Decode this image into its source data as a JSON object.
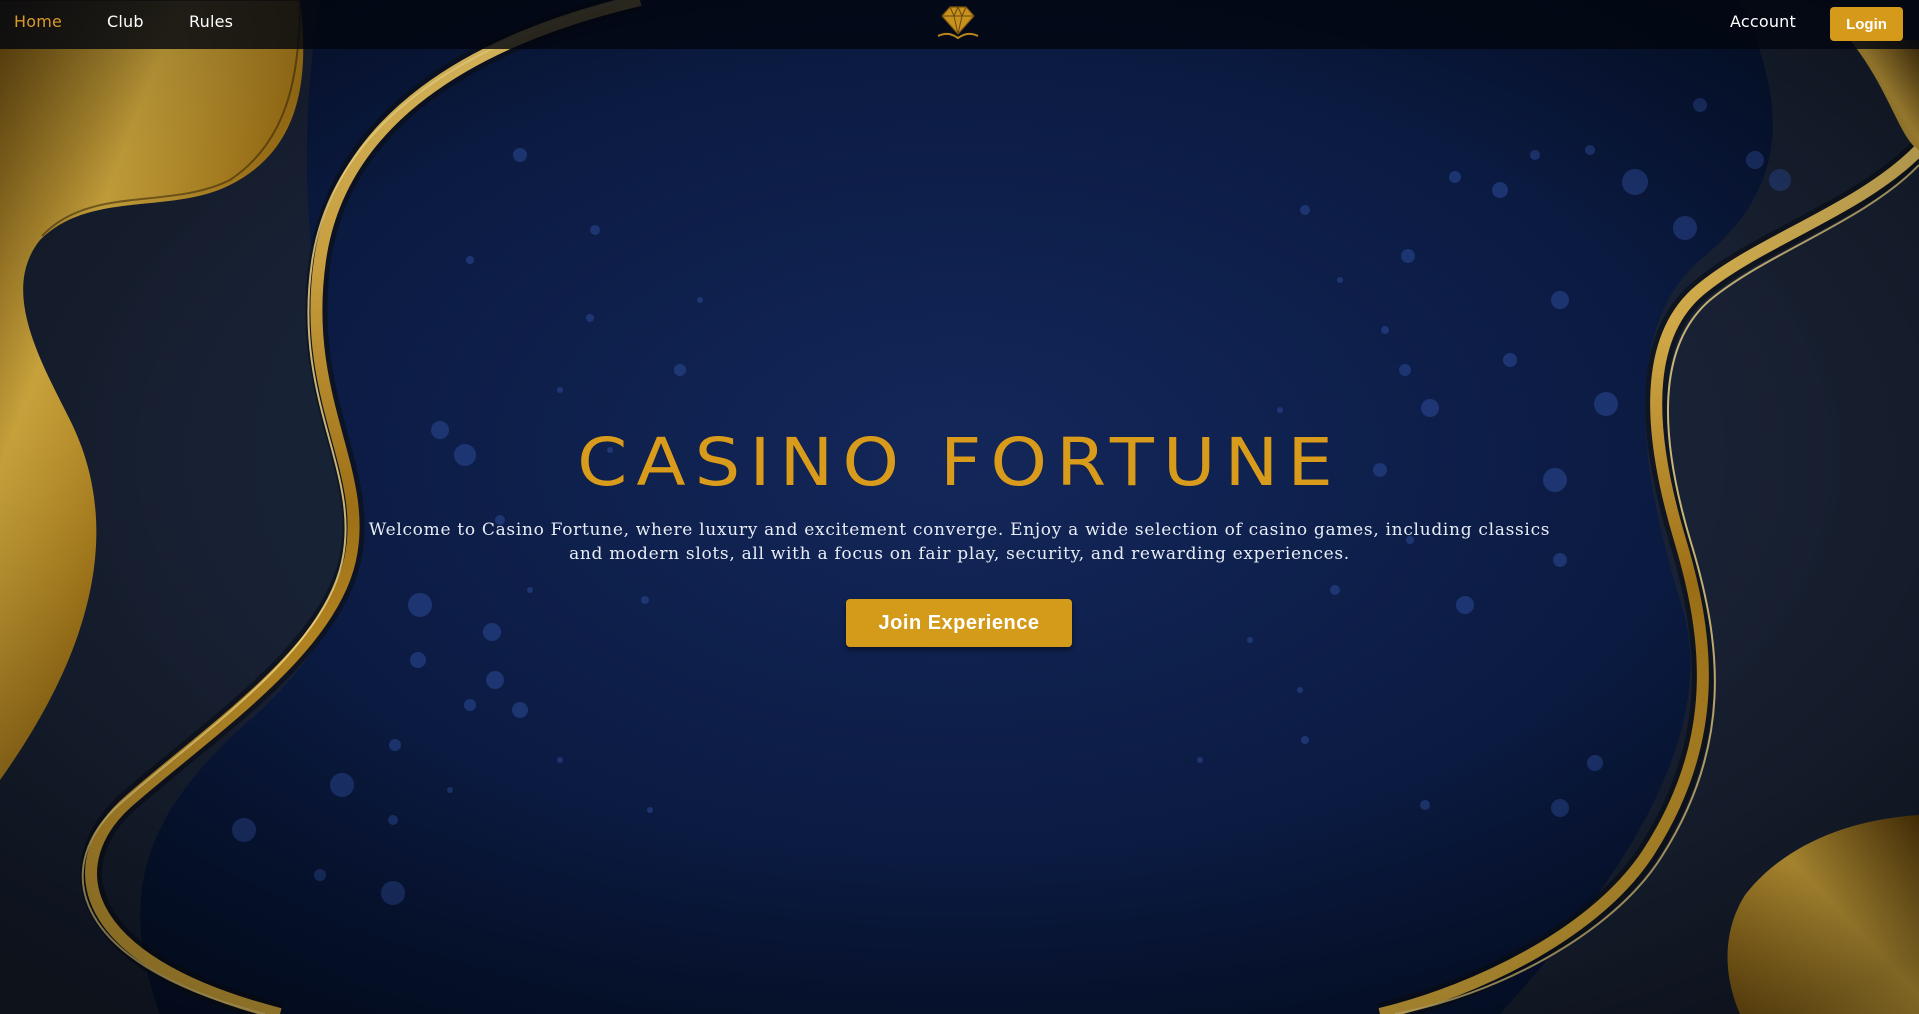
{
  "nav": {
    "home": "Home",
    "club": "Club",
    "rules": "Rules",
    "account": "Account",
    "login": "Login",
    "logo_icon": "diamond-logo-icon"
  },
  "hero": {
    "title": "CASINO FORTUNE",
    "description": "Welcome to Casino Fortune, where luxury and excitement converge. Enjoy a wide selection of casino games, including classics and modern slots, all with a focus on fair play, security, and rewarding experiences.",
    "cta": "Join Experience"
  },
  "colors": {
    "accent_gold": "#d69a1a",
    "active_nav": "#d99a2b",
    "background_navy": "#0c1c45"
  }
}
